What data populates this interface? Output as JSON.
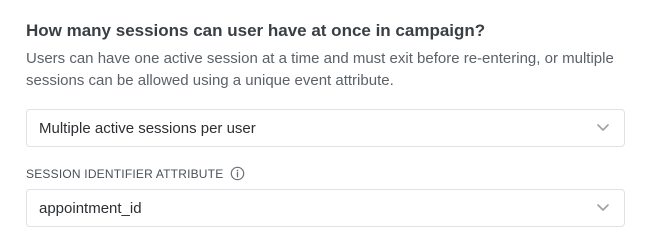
{
  "section": {
    "title": "How many sessions can user have at once in campaign?",
    "description": "Users can have one active session at a time and must exit before re-entering, or multiple sessions can be allowed using a unique event attribute."
  },
  "session_mode_select": {
    "value": "Multiple active sessions per user",
    "icon": "chevron-down-icon"
  },
  "session_identifier": {
    "label": "SESSION IDENTIFIER ATTRIBUTE",
    "info_icon": "info-icon",
    "value": "appointment_id",
    "icon": "chevron-down-icon"
  },
  "colors": {
    "border": "#dfe2e6",
    "chevron": "#9aa0a6",
    "title": "#3a3f44",
    "description": "#5b6168"
  }
}
